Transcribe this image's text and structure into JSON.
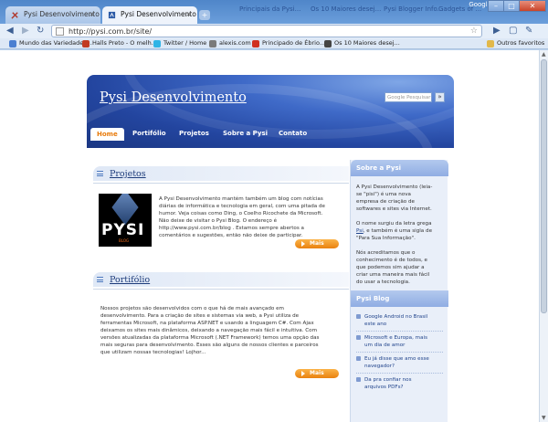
{
  "browser": {
    "tabs": [
      {
        "label": "Pysi Desenvolvimento",
        "active": false
      },
      {
        "label": "Pysi Desenvolvimento",
        "active": true
      }
    ],
    "new_tab_glyph": "+",
    "background_window_titles": [
      "Principais da Pysi...",
      "Os 10 Maiores desej...",
      "Pysi Blogger Info...",
      "Gadgets of ..."
    ],
    "window_buttons": {
      "minimize": "–",
      "maximize": "□",
      "close": "✕"
    },
    "google_label": "Google",
    "url": "http://pysi.com.br/site/",
    "bookmarks": [
      {
        "label": "Mundo das Variedades...",
        "icon": "globe-icon",
        "color": "#4a7fd1"
      },
      {
        "label": "Halls Preto - O melh...",
        "icon": "page-icon",
        "color": "#c23b22"
      },
      {
        "label": "Twitter / Home",
        "icon": "twitter-icon",
        "color": "#2fb4e6"
      },
      {
        "label": "alexis.com",
        "icon": "page-icon",
        "color": "#7a7a7a"
      },
      {
        "label": "Principado de Ébrio...",
        "icon": "page-icon",
        "color": "#d03020"
      },
      {
        "label": "Os 10 Maiores desej...",
        "icon": "page-icon",
        "color": "#444"
      }
    ],
    "other_bookmarks": "Outros favoritos"
  },
  "site": {
    "title": "Pysi Desenvolvimento",
    "search_placeholder": "Google Pesquisar",
    "search_button": "»",
    "nav": [
      {
        "label": "Home",
        "active": true
      },
      {
        "label": "Portifólio",
        "active": false
      },
      {
        "label": "Projetos",
        "active": false
      },
      {
        "label": "Sobre a Pysi",
        "active": false
      },
      {
        "label": "Contato",
        "active": false
      }
    ],
    "projetos": {
      "title": "Projetos",
      "logo_text": "PYSI",
      "logo_sub": "BLOG",
      "lines": [
        "A Pysi Desenvolvimento mantém também um blog com notícias",
        "diárias de informática e tecnologia em geral, com uma pitada de",
        "humor. Veja coisas como Ding, o Coelho Ricochete da Microsoft.",
        "Não deixe de visitar o Pysi Blog. O endereço é",
        "http://www.pysi.com.br/blog . Estamos sempre abertos a",
        "comentários e sugestões, então não deixe de participar."
      ],
      "more": "Mais"
    },
    "portfolio": {
      "title": "Portifólio",
      "lines": [
        "Nossos projetos são desenvolvidos com o que há de mais avançado em",
        "desenvolvimento. Para a criação de sites e sistemas via web, a Pysi utiliza de",
        "ferramentas Microsoft, na plataforma ASP.NET e usando a linguagem C#. Com Ajax",
        "deixamos os sites mais dinâmicos, deixando a navegação mais fácil e intuitiva. Com",
        "versões atualizadas da plataforma Microsoft (.NET Framework) temos uma opção das",
        "mais seguras para desenvolvimento. Esses são alguns de nossos clientes e parceiros",
        "que utilizam nossas tecnologias! Lojhor..."
      ],
      "more": "Mais"
    },
    "sidebar": {
      "about_title": "Sobre a Pysi",
      "about_p1": [
        "A Pysi Desenvolvimento (leia-",
        "se \"pisi\") é uma nova",
        "empresa de criação de",
        "softwares e sites via Internet."
      ],
      "about_p2_prefix": "O nome surgiu da letra grega",
      "about_p2_link": "Psi",
      "about_p2_rest": [
        ", e também é uma sigla de",
        "\"Para Sua Informação\"."
      ],
      "about_p3": [
        "Nós acreditamos que o",
        "conhecimento é de todos, e",
        "que podemos sim ajudar a",
        "criar uma maneira mais fácil",
        "do usar a tecnologia."
      ],
      "blog_title": "Pysi Blog",
      "blog_items": [
        [
          "Google Android no Brasil",
          "este ano"
        ],
        [
          "Microsoft e Europa, mais",
          "um dia de amor"
        ],
        [
          "Eu já disse que amo esse",
          "navegador?"
        ],
        [
          "Da pra confiar nos",
          "arquivos PDFs?"
        ]
      ]
    }
  }
}
